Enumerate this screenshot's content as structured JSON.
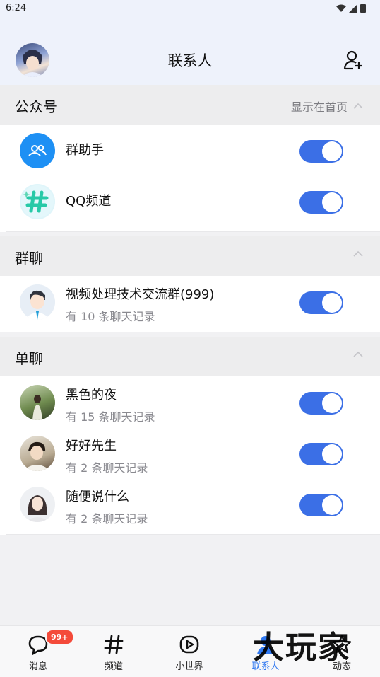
{
  "status": {
    "time": "6:24"
  },
  "header": {
    "title": "联系人"
  },
  "sections": {
    "official": {
      "label": "公众号",
      "right_label": "显示在首页"
    },
    "group_chat": {
      "label": "群聊"
    },
    "single_chat": {
      "label": "单聊"
    }
  },
  "official_items": [
    {
      "name": "群助手",
      "icon": "group-helper-icon",
      "enabled": true
    },
    {
      "name": "QQ频道",
      "icon": "qq-channel-icon",
      "enabled": true
    }
  ],
  "group_items": [
    {
      "name": "视频处理技术交流群(999)",
      "sub": "有 10 条聊天记录",
      "enabled": true
    }
  ],
  "single_items": [
    {
      "name": "黑色的夜",
      "sub": "有 15 条聊天记录",
      "enabled": true
    },
    {
      "name": "好好先生",
      "sub": "有 2 条聊天记录",
      "enabled": true
    },
    {
      "name": "随便说什么",
      "sub": "有 2 条聊天记录",
      "enabled": true
    }
  ],
  "tabbar": {
    "tabs": [
      {
        "label": "消息",
        "icon": "message-icon",
        "badge": "99+"
      },
      {
        "label": "频道",
        "icon": "hash-icon"
      },
      {
        "label": "小世界",
        "icon": "play-icon"
      },
      {
        "label": "联系人",
        "icon": "contacts-icon",
        "active": true
      },
      {
        "label": "动态",
        "icon": "star-icon"
      }
    ]
  },
  "watermark": "大玩家",
  "colors": {
    "accent": "#3b6fe6",
    "tab_active": "#2f78f1",
    "badge": "#f44a3a"
  }
}
